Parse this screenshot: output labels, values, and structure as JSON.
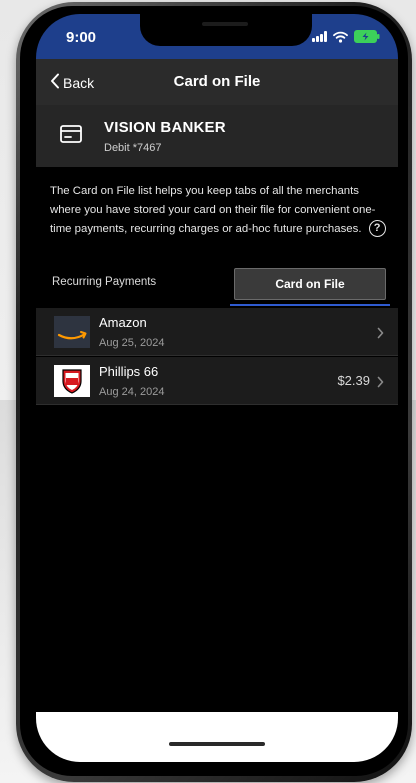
{
  "status_bar": {
    "time": "9:00",
    "icons": [
      "signal-icon",
      "wifi-icon",
      "battery-icon"
    ],
    "accent_color": "#1e3f8c",
    "battery_color": "#3cd05a"
  },
  "nav": {
    "back_label": "Back",
    "title": "Card on File"
  },
  "account": {
    "name": "VISION BANKER",
    "subtitle": "Debit *7467",
    "icon": "card-icon"
  },
  "description": {
    "text": "The Card on File list helps you keep tabs of all the merchants where you have stored your card on their file for convenient one-time payments, recurring charges or ad-hoc future purchases.",
    "help_icon_glyph": "?"
  },
  "tabs": [
    {
      "label": "Recurring Payments",
      "active": false
    },
    {
      "label": "Card on File",
      "active": true
    }
  ],
  "merchants": [
    {
      "name": "Amazon",
      "date": "Aug 25, 2024",
      "amount": "",
      "logo": "amazon-logo"
    },
    {
      "name": "Phillips 66",
      "date": "Aug 24, 2024",
      "amount": "$2.39",
      "logo": "phillips-66-logo"
    }
  ]
}
